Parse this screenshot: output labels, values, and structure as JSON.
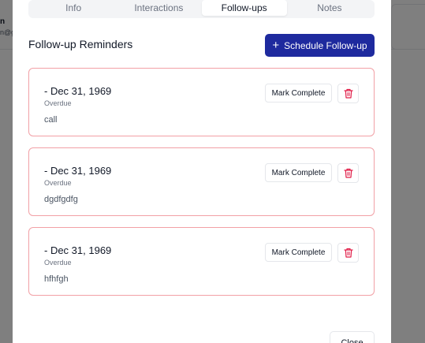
{
  "background": {
    "name_fragment": "n",
    "email_fragment": "n@g"
  },
  "tabs": [
    {
      "label": "Info",
      "active": false
    },
    {
      "label": "Interactions",
      "active": false
    },
    {
      "label": "Follow-ups",
      "active": true
    },
    {
      "label": "Notes",
      "active": false
    }
  ],
  "section": {
    "title": "Follow-up Reminders",
    "schedule_button": "Schedule Follow-up"
  },
  "reminders": [
    {
      "date": "- Dec 31, 1969",
      "status": "Overdue",
      "note": "call",
      "mark_label": "Mark Complete"
    },
    {
      "date": "- Dec 31, 1969",
      "status": "Overdue",
      "note": "dgdfgdfg",
      "mark_label": "Mark Complete"
    },
    {
      "date": "- Dec 31, 1969",
      "status": "Overdue",
      "note": "hfhfgh",
      "mark_label": "Mark Complete"
    }
  ],
  "footer": {
    "close_label": "Close"
  },
  "colors": {
    "primary": "#1e2a9e",
    "overdue_border": "#f2a0a6",
    "danger_icon": "#e11d48",
    "overlay": "rgba(0,0,0,0.5)"
  }
}
